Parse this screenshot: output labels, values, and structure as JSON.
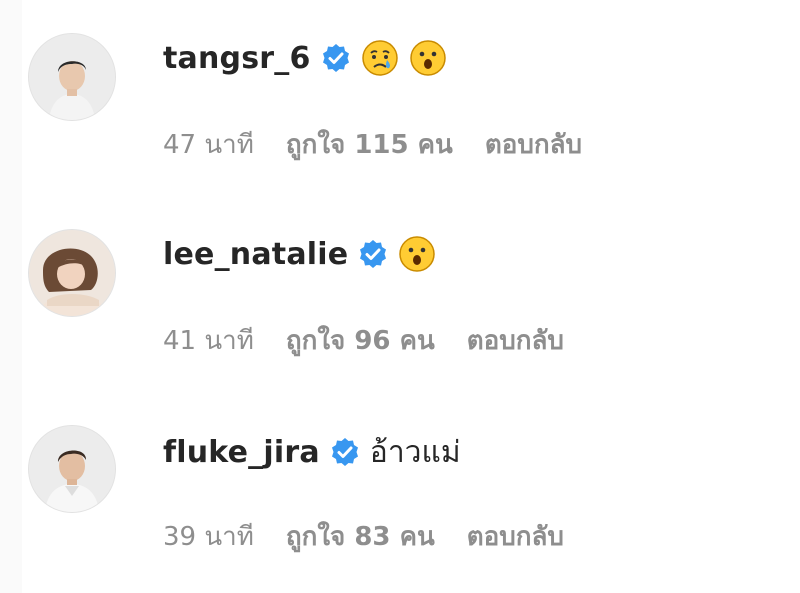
{
  "comments": [
    {
      "username": "tangsr_6",
      "verified": true,
      "text": "",
      "emoji": [
        "crying-face-emoji",
        "surprised-face-emoji"
      ],
      "time": "47 นาที",
      "likes": "ถูกใจ 115 คน",
      "reply": "ตอบกลับ"
    },
    {
      "username": "lee_natalie",
      "verified": true,
      "text": "",
      "emoji": [
        "surprised-face-emoji"
      ],
      "time": "41 นาที",
      "likes": "ถูกใจ 96 คน",
      "reply": "ตอบกลับ"
    },
    {
      "username": "fluke_jira",
      "verified": true,
      "text": "อ้าวแม่",
      "emoji": [],
      "time": "39 นาที",
      "likes": "ถูกใจ 83 คน",
      "reply": "ตอบกลับ"
    }
  ],
  "colors": {
    "text": "#262626",
    "meta": "#8e8e8e",
    "verified_blue": "#3897f0",
    "emoji_yellow": "#ffcc33",
    "tear_blue": "#4aa8f0"
  }
}
